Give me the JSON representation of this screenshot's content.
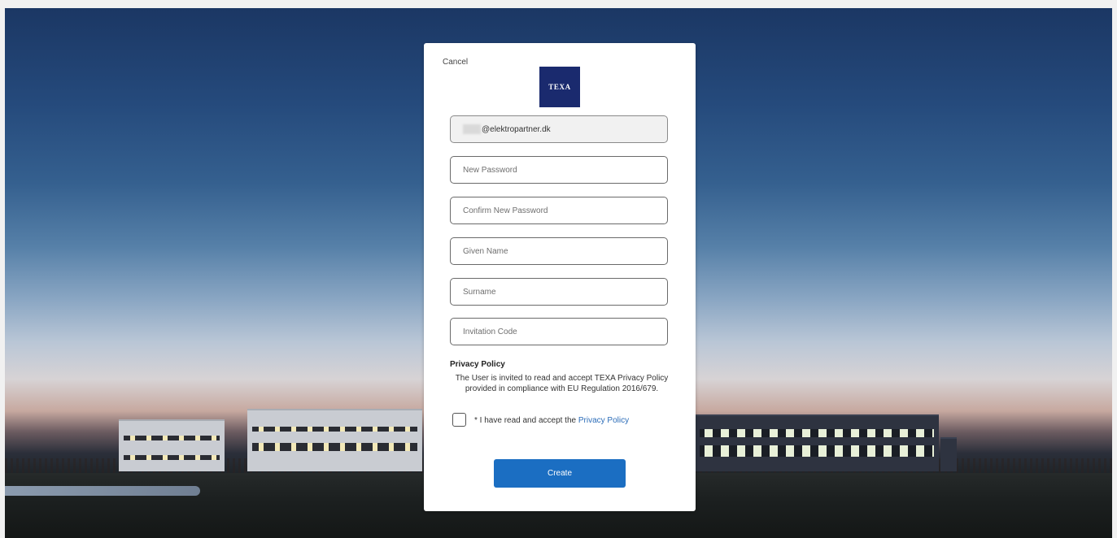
{
  "card": {
    "cancel_label": "Cancel",
    "logo_text": "TEXA",
    "email_value": "@elektropartner.dk",
    "fields": {
      "new_password_placeholder": "New Password",
      "confirm_password_placeholder": "Confirm New Password",
      "given_name_placeholder": "Given Name",
      "surname_placeholder": "Surname",
      "invitation_code_placeholder": "Invitation Code"
    },
    "privacy": {
      "title": "Privacy Policy",
      "text": "The User is invited to read and accept TEXA Privacy Policy provided in compliance with EU Regulation 2016/679.",
      "checkbox_label": "* I have read and accept the",
      "link_label": "Privacy Policy",
      "accepted": false
    },
    "create_label": "Create"
  },
  "colors": {
    "primary_button": "#1b6ec2",
    "link": "#2b6cb8",
    "logo_bg": "#1a2a6e"
  }
}
